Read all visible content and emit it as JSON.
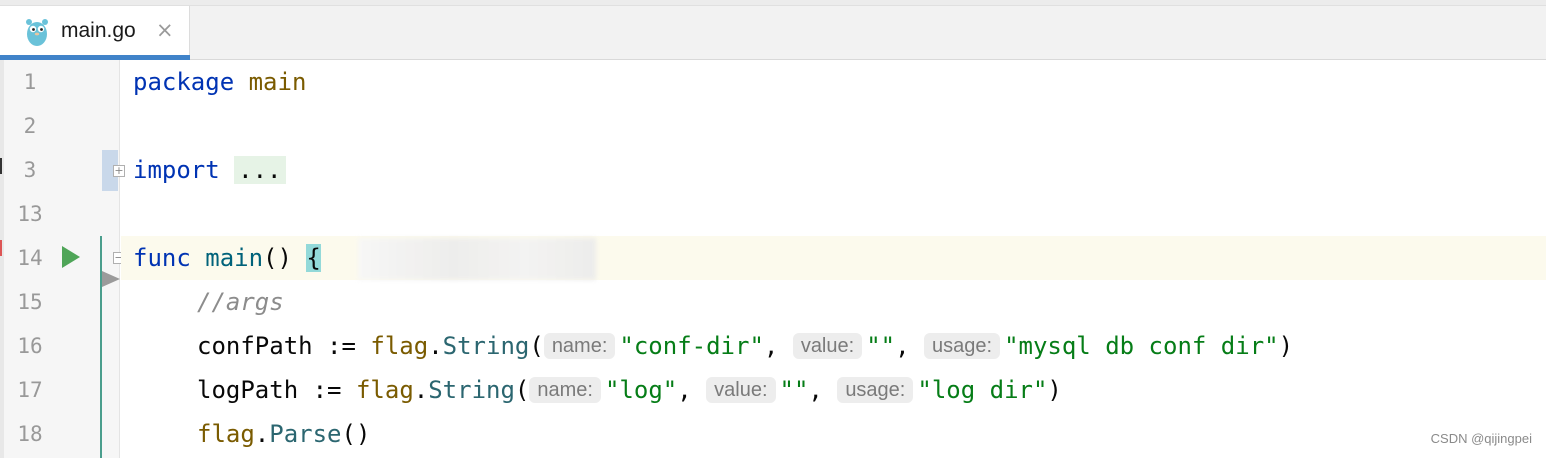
{
  "tab": {
    "filename": "main.go",
    "close_glyph": "×",
    "icon": "gopher-icon"
  },
  "gutter": {
    "line_numbers": [
      "1",
      "2",
      "3",
      "13",
      "14",
      "15",
      "16",
      "17",
      "18"
    ],
    "run_icon": "run-triangle-icon"
  },
  "code": {
    "l1": {
      "kw": "package",
      "name": "main"
    },
    "l3": {
      "kw": "import",
      "placeholder": "..."
    },
    "l14": {
      "kw": "func",
      "name": "main",
      "parens": "()",
      "brace": "{"
    },
    "l15": {
      "comment": "//args"
    },
    "l16": {
      "var": "confPath",
      "op": ":=",
      "pkg": "flag",
      "dot": ".",
      "fn": "String",
      "open": "(",
      "h1": "name:",
      "a1": "\"conf-dir\"",
      "sep1": ",",
      "h2": "value:",
      "a2": "\"\"",
      "sep2": ",",
      "h3": "usage:",
      "a3": "\"mysql db conf dir\"",
      "close": ")"
    },
    "l17": {
      "var": "logPath",
      "op": ":=",
      "pkg": "flag",
      "dot": ".",
      "fn": "String",
      "open": "(",
      "h1": "name:",
      "a1": "\"log\"",
      "sep1": ",",
      "h2": "value:",
      "a2": "\"\"",
      "sep2": ",",
      "h3": "usage:",
      "a3": "\"log dir\"",
      "close": ")"
    },
    "l18": {
      "pkg": "flag",
      "dot": ".",
      "fn": "Parse",
      "parens": "()"
    }
  },
  "watermark": "CSDN @qijingpei",
  "colors": {
    "keyword": "#0033b3",
    "string": "#067d17",
    "package": "#7a5b00",
    "accent": "#4083c9",
    "run": "#4fa558"
  }
}
